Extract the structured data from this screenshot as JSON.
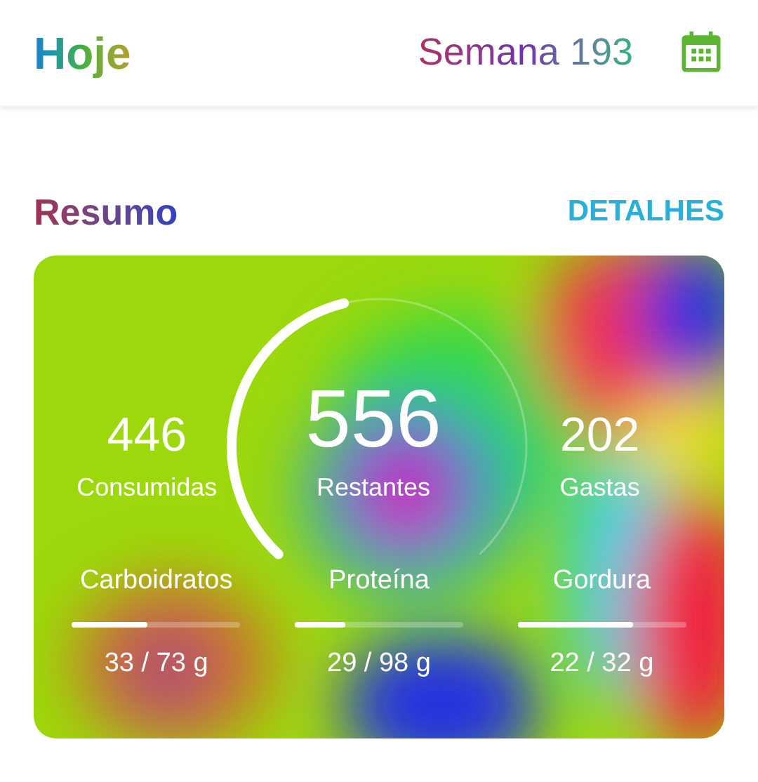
{
  "header": {
    "title": "Hoje",
    "week": "Semana 193"
  },
  "summary": {
    "title": "Resumo",
    "details_link": "DETALHES",
    "gauge": {
      "level": 0.45
    },
    "stats": [
      {
        "value": "446",
        "label": "Consumidas",
        "kind": "side"
      },
      {
        "value": "556",
        "label": "Restantes",
        "kind": "main"
      },
      {
        "value": "202",
        "label": "Gastas",
        "kind": "side"
      }
    ],
    "macros": [
      {
        "name": "Carboidratos",
        "level": 0.45,
        "reading": "33 / 73 g"
      },
      {
        "name": "Proteína",
        "level": 0.3,
        "reading": "29 / 98 g"
      },
      {
        "name": "Gordura",
        "level": 0.69,
        "reading": "22 / 32 g"
      }
    ]
  }
}
